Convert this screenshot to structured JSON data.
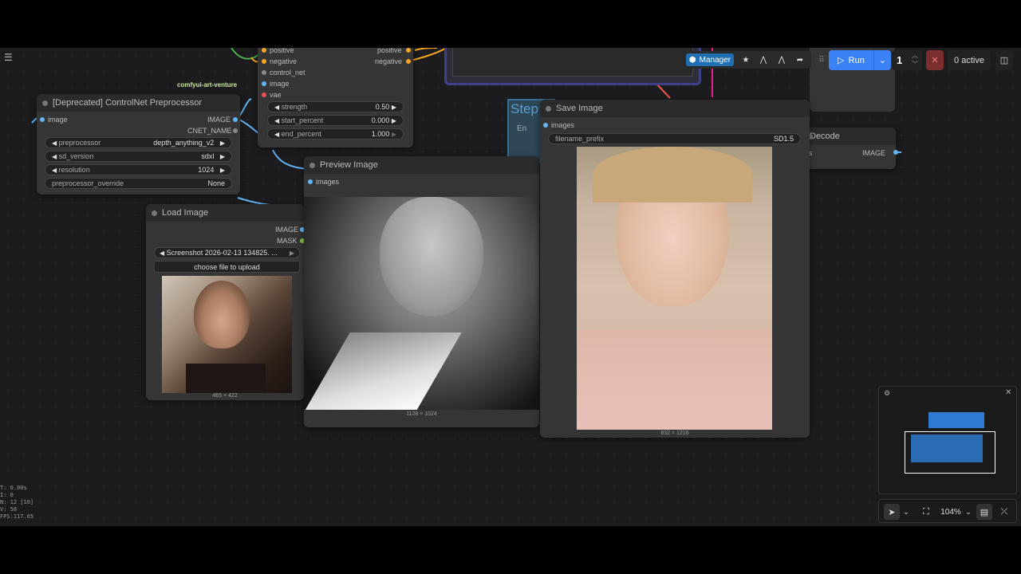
{
  "graph": {
    "upper_node": {
      "inputs": [
        "positive",
        "negative",
        "control_net",
        "image",
        "vae"
      ],
      "outputs": [
        "positive",
        "negative"
      ],
      "widgets": [
        {
          "label": "strength",
          "value": "0.50"
        },
        {
          "label": "start_percent",
          "value": "0.000"
        },
        {
          "label": "end_percent",
          "value": "1.000"
        }
      ]
    },
    "group_label": "comfyui-art-venture",
    "preprocessor_node": {
      "title": "[Deprecated] ControlNet Preprocessor",
      "input": "image",
      "outputs": [
        "IMAGE",
        "CNET_NAME"
      ],
      "widgets": [
        {
          "label": "preprocessor",
          "value": "depth_anything_v2"
        },
        {
          "label": "sd_version",
          "value": "sdxl"
        },
        {
          "label": "resolution",
          "value": "1024"
        },
        {
          "label": "preprocessor_override",
          "value": "None"
        }
      ]
    },
    "load_image_node": {
      "title": "Load Image",
      "outputs": [
        "IMAGE",
        "MASK"
      ],
      "file": "Screenshot 2026-02-13 134825. ...",
      "upload_button": "choose file to upload",
      "dimensions": "465 × 422"
    },
    "preview_image_node": {
      "title": "Preview Image",
      "input": "images",
      "dimensions": "1128 × 1024"
    },
    "save_image_node": {
      "title": "Save Image",
      "input": "images",
      "widget": {
        "label": "filename_prefix",
        "value": "SD1.5"
      },
      "dimensions": "832 × 1216"
    },
    "step_group_label": "Step",
    "partial_en": "En",
    "decode_node": {
      "title": "Decode",
      "output": "IMAGE",
      "partial_input": "s"
    }
  },
  "toolbar": {
    "manager_label": "Manager",
    "run_label": "Run",
    "queue_count": "1",
    "active_label": "0 active"
  },
  "bottom_toolbar": {
    "zoom": "104%"
  },
  "stats": [
    "T: 0.00s",
    "I: 0",
    "N: 12 [10]",
    "V: 58",
    "FPS:117.65"
  ],
  "colors": {
    "accent": "#3b82f6",
    "conditioning": "#f5a623",
    "image_link": "#64b5f6",
    "vae": "#ef5350"
  }
}
